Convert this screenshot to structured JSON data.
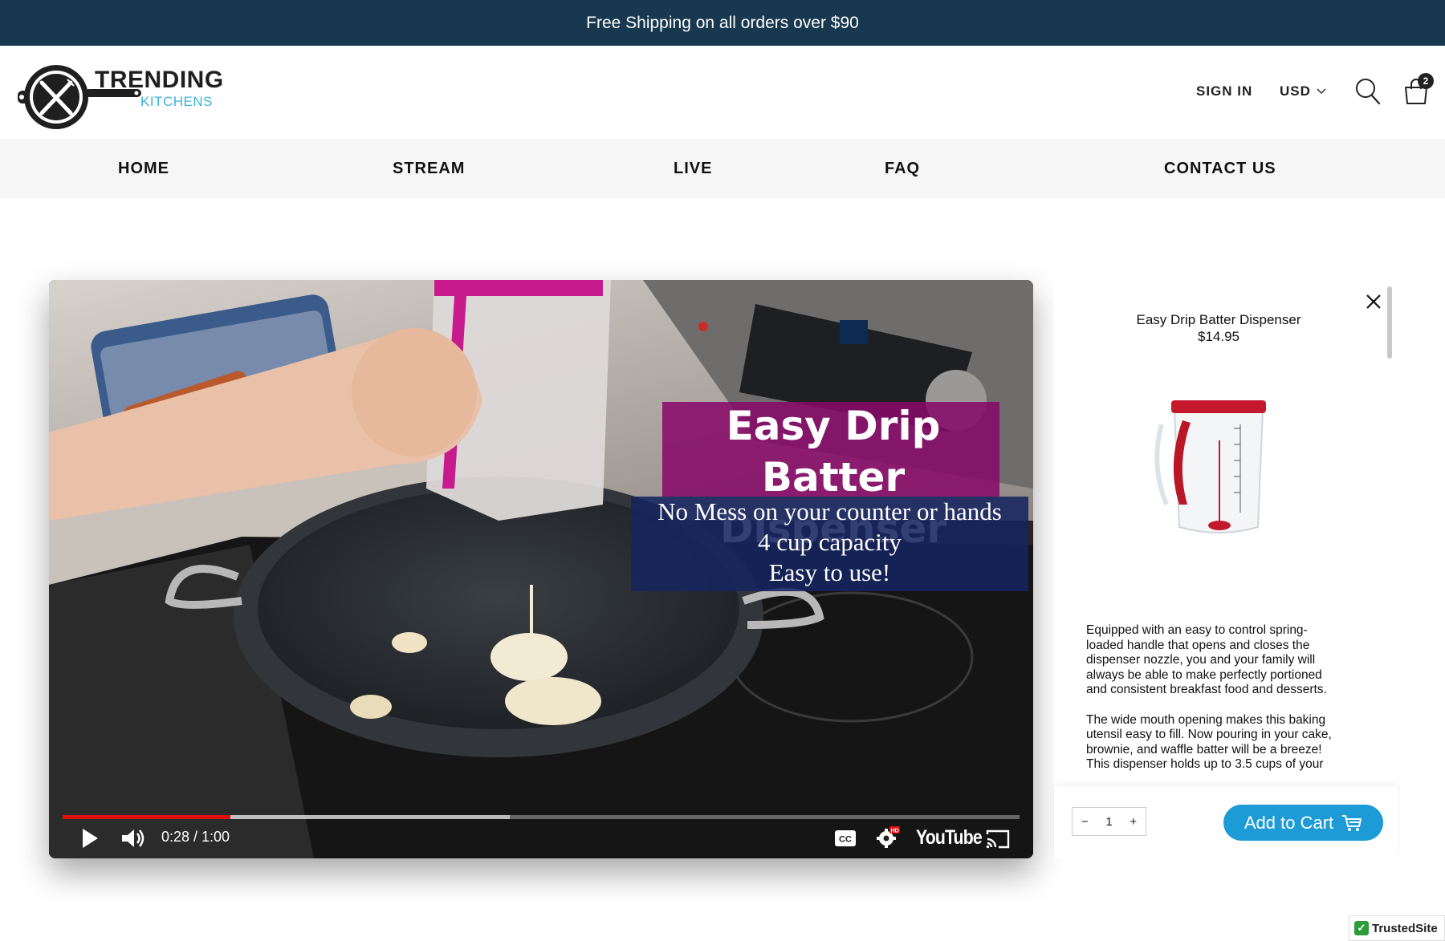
{
  "announcement": "Free Shipping on all orders over $90",
  "brand": {
    "line1": "TRENDING",
    "line2": "KITCHENS"
  },
  "header": {
    "sign_in": "SIGN IN",
    "currency": "USD",
    "cart_count": "2",
    "icons": [
      "search-icon",
      "cart-icon",
      "chevron-down-icon"
    ]
  },
  "nav": [
    "HOME",
    "STREAM",
    "LIVE",
    "FAQ",
    "CONTACT US"
  ],
  "video": {
    "overlay_title": [
      "Easy Drip",
      "Batter Dispenser"
    ],
    "overlay_sub": [
      "No Mess on your counter or hands",
      "4 cup capacity",
      "Easy to use!"
    ],
    "time": "0:28 / 1:00",
    "progress": 0.467,
    "buffered": 0.175,
    "platform": "YouTube",
    "colors": {
      "progress": "#e01010",
      "title_bg": "#870a69",
      "sub_bg": "#16245f"
    }
  },
  "product": {
    "name": "Easy Drip Batter Dispenser",
    "price": "$14.95",
    "description": [
      "Equipped with an easy to control spring-loaded handle that opens and closes the dispenser nozzle, you and your family will always be able to make perfectly portioned and consistent breakfast food and desserts.",
      "The wide mouth opening makes this baking utensil easy to fill. Now pouring in your cake, brownie, and waffle batter will be a breeze! This dispenser holds up to 3.5 cups of your"
    ],
    "quantity": "1",
    "add_to_cart": "Add to Cart",
    "accent": "#1d9bd7"
  },
  "trust_badge": "TrustedSite"
}
